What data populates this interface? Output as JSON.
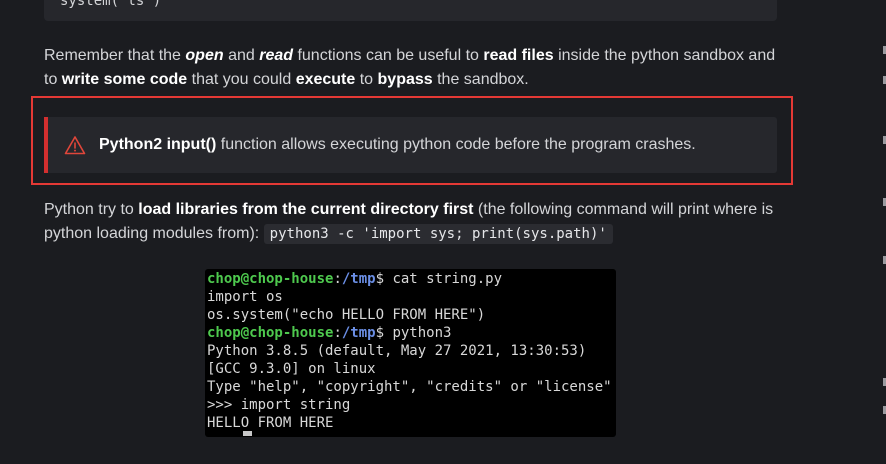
{
  "top_code": {
    "line": "system('ls')"
  },
  "paragraph1": {
    "t1": "Remember that the ",
    "open": "open",
    "t2": " and ",
    "read": "read",
    "t3": " functions can be useful to ",
    "read_files": "read files",
    "t4": " inside the python sandbox and",
    "t5": "to ",
    "write_code": "write some code",
    "t6": " that you could ",
    "execute": "execute",
    "t7": " to ",
    "bypass": "bypass",
    "t8": " the sandbox."
  },
  "hint": {
    "icon": "warning-triangle-icon",
    "bold": "Python2 input()",
    "text": " function allows executing python code before the program crashes.",
    "accent_color": "#d32f2f",
    "outline_color": "#e53935"
  },
  "paragraph2": {
    "t1": "Python try to ",
    "bold": "load libraries from the current directory first",
    "t2": " (the following command will print where is",
    "t3": "python loading modules from): ",
    "code": "python3 -c 'import sys; print(sys.path)'"
  },
  "terminal": {
    "user": "chop@chop-house",
    "colon": ":",
    "path": "/tmp",
    "prompt": "$ ",
    "cmd1": "cat string.py",
    "line2": "import os",
    "line3": "os.system(\"echo HELLO FROM HERE\")",
    "cmd2": "python3",
    "line5": "Python 3.8.5 (default, May 27 2021, 13:30:53)",
    "line6": "[GCC 9.3.0] on linux",
    "line7": "Type \"help\", \"copyright\", \"credits\" or \"license\" for more information.",
    "line8": ">>> import string",
    "line9": "HELLO FROM HERE"
  }
}
